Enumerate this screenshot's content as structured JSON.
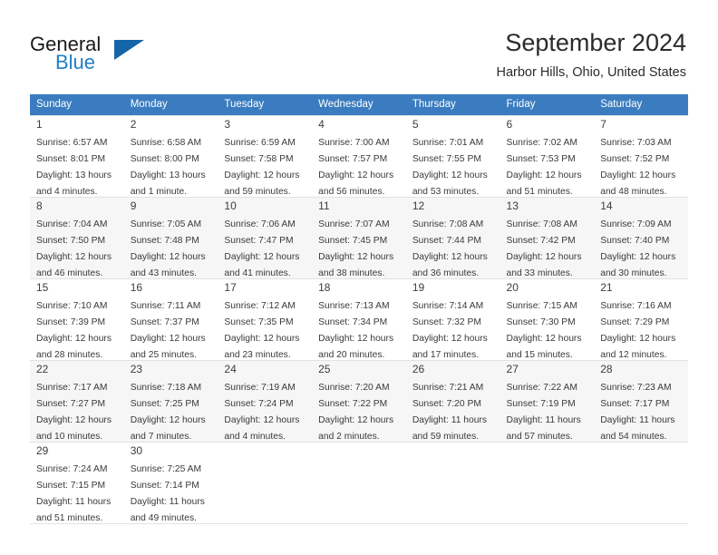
{
  "brand": {
    "word_one": "General",
    "word_two": "Blue",
    "accent_color": "#1565a8",
    "blue_text_color": "#1f7fc4",
    "triangle_icon": "triangle-logo-icon"
  },
  "header": {
    "title": "September 2024",
    "subtitle": "Harbor Hills, Ohio, United States"
  },
  "calendar": {
    "header_background": "#3a7cbf",
    "header_text_color": "#ffffff",
    "weekdays": [
      "Sunday",
      "Monday",
      "Tuesday",
      "Wednesday",
      "Thursday",
      "Friday",
      "Saturday"
    ],
    "weeks": [
      [
        {
          "day": "1",
          "sunrise": "Sunrise: 6:57 AM",
          "sunset": "Sunset: 8:01 PM",
          "daylight": "Daylight: 13 hours and 4 minutes."
        },
        {
          "day": "2",
          "sunrise": "Sunrise: 6:58 AM",
          "sunset": "Sunset: 8:00 PM",
          "daylight": "Daylight: 13 hours and 1 minute."
        },
        {
          "day": "3",
          "sunrise": "Sunrise: 6:59 AM",
          "sunset": "Sunset: 7:58 PM",
          "daylight": "Daylight: 12 hours and 59 minutes."
        },
        {
          "day": "4",
          "sunrise": "Sunrise: 7:00 AM",
          "sunset": "Sunset: 7:57 PM",
          "daylight": "Daylight: 12 hours and 56 minutes."
        },
        {
          "day": "5",
          "sunrise": "Sunrise: 7:01 AM",
          "sunset": "Sunset: 7:55 PM",
          "daylight": "Daylight: 12 hours and 53 minutes."
        },
        {
          "day": "6",
          "sunrise": "Sunrise: 7:02 AM",
          "sunset": "Sunset: 7:53 PM",
          "daylight": "Daylight: 12 hours and 51 minutes."
        },
        {
          "day": "7",
          "sunrise": "Sunrise: 7:03 AM",
          "sunset": "Sunset: 7:52 PM",
          "daylight": "Daylight: 12 hours and 48 minutes."
        }
      ],
      [
        {
          "day": "8",
          "sunrise": "Sunrise: 7:04 AM",
          "sunset": "Sunset: 7:50 PM",
          "daylight": "Daylight: 12 hours and 46 minutes."
        },
        {
          "day": "9",
          "sunrise": "Sunrise: 7:05 AM",
          "sunset": "Sunset: 7:48 PM",
          "daylight": "Daylight: 12 hours and 43 minutes."
        },
        {
          "day": "10",
          "sunrise": "Sunrise: 7:06 AM",
          "sunset": "Sunset: 7:47 PM",
          "daylight": "Daylight: 12 hours and 41 minutes."
        },
        {
          "day": "11",
          "sunrise": "Sunrise: 7:07 AM",
          "sunset": "Sunset: 7:45 PM",
          "daylight": "Daylight: 12 hours and 38 minutes."
        },
        {
          "day": "12",
          "sunrise": "Sunrise: 7:08 AM",
          "sunset": "Sunset: 7:44 PM",
          "daylight": "Daylight: 12 hours and 36 minutes."
        },
        {
          "day": "13",
          "sunrise": "Sunrise: 7:08 AM",
          "sunset": "Sunset: 7:42 PM",
          "daylight": "Daylight: 12 hours and 33 minutes."
        },
        {
          "day": "14",
          "sunrise": "Sunrise: 7:09 AM",
          "sunset": "Sunset: 7:40 PM",
          "daylight": "Daylight: 12 hours and 30 minutes."
        }
      ],
      [
        {
          "day": "15",
          "sunrise": "Sunrise: 7:10 AM",
          "sunset": "Sunset: 7:39 PM",
          "daylight": "Daylight: 12 hours and 28 minutes."
        },
        {
          "day": "16",
          "sunrise": "Sunrise: 7:11 AM",
          "sunset": "Sunset: 7:37 PM",
          "daylight": "Daylight: 12 hours and 25 minutes."
        },
        {
          "day": "17",
          "sunrise": "Sunrise: 7:12 AM",
          "sunset": "Sunset: 7:35 PM",
          "daylight": "Daylight: 12 hours and 23 minutes."
        },
        {
          "day": "18",
          "sunrise": "Sunrise: 7:13 AM",
          "sunset": "Sunset: 7:34 PM",
          "daylight": "Daylight: 12 hours and 20 minutes."
        },
        {
          "day": "19",
          "sunrise": "Sunrise: 7:14 AM",
          "sunset": "Sunset: 7:32 PM",
          "daylight": "Daylight: 12 hours and 17 minutes."
        },
        {
          "day": "20",
          "sunrise": "Sunrise: 7:15 AM",
          "sunset": "Sunset: 7:30 PM",
          "daylight": "Daylight: 12 hours and 15 minutes."
        },
        {
          "day": "21",
          "sunrise": "Sunrise: 7:16 AM",
          "sunset": "Sunset: 7:29 PM",
          "daylight": "Daylight: 12 hours and 12 minutes."
        }
      ],
      [
        {
          "day": "22",
          "sunrise": "Sunrise: 7:17 AM",
          "sunset": "Sunset: 7:27 PM",
          "daylight": "Daylight: 12 hours and 10 minutes."
        },
        {
          "day": "23",
          "sunrise": "Sunrise: 7:18 AM",
          "sunset": "Sunset: 7:25 PM",
          "daylight": "Daylight: 12 hours and 7 minutes."
        },
        {
          "day": "24",
          "sunrise": "Sunrise: 7:19 AM",
          "sunset": "Sunset: 7:24 PM",
          "daylight": "Daylight: 12 hours and 4 minutes."
        },
        {
          "day": "25",
          "sunrise": "Sunrise: 7:20 AM",
          "sunset": "Sunset: 7:22 PM",
          "daylight": "Daylight: 12 hours and 2 minutes."
        },
        {
          "day": "26",
          "sunrise": "Sunrise: 7:21 AM",
          "sunset": "Sunset: 7:20 PM",
          "daylight": "Daylight: 11 hours and 59 minutes."
        },
        {
          "day": "27",
          "sunrise": "Sunrise: 7:22 AM",
          "sunset": "Sunset: 7:19 PM",
          "daylight": "Daylight: 11 hours and 57 minutes."
        },
        {
          "day": "28",
          "sunrise": "Sunrise: 7:23 AM",
          "sunset": "Sunset: 7:17 PM",
          "daylight": "Daylight: 11 hours and 54 minutes."
        }
      ],
      [
        {
          "day": "29",
          "sunrise": "Sunrise: 7:24 AM",
          "sunset": "Sunset: 7:15 PM",
          "daylight": "Daylight: 11 hours and 51 minutes."
        },
        {
          "day": "30",
          "sunrise": "Sunrise: 7:25 AM",
          "sunset": "Sunset: 7:14 PM",
          "daylight": "Daylight: 11 hours and 49 minutes."
        },
        {
          "day": "",
          "sunrise": "",
          "sunset": "",
          "daylight": ""
        },
        {
          "day": "",
          "sunrise": "",
          "sunset": "",
          "daylight": ""
        },
        {
          "day": "",
          "sunrise": "",
          "sunset": "",
          "daylight": ""
        },
        {
          "day": "",
          "sunrise": "",
          "sunset": "",
          "daylight": ""
        },
        {
          "day": "",
          "sunrise": "",
          "sunset": "",
          "daylight": ""
        }
      ]
    ]
  }
}
